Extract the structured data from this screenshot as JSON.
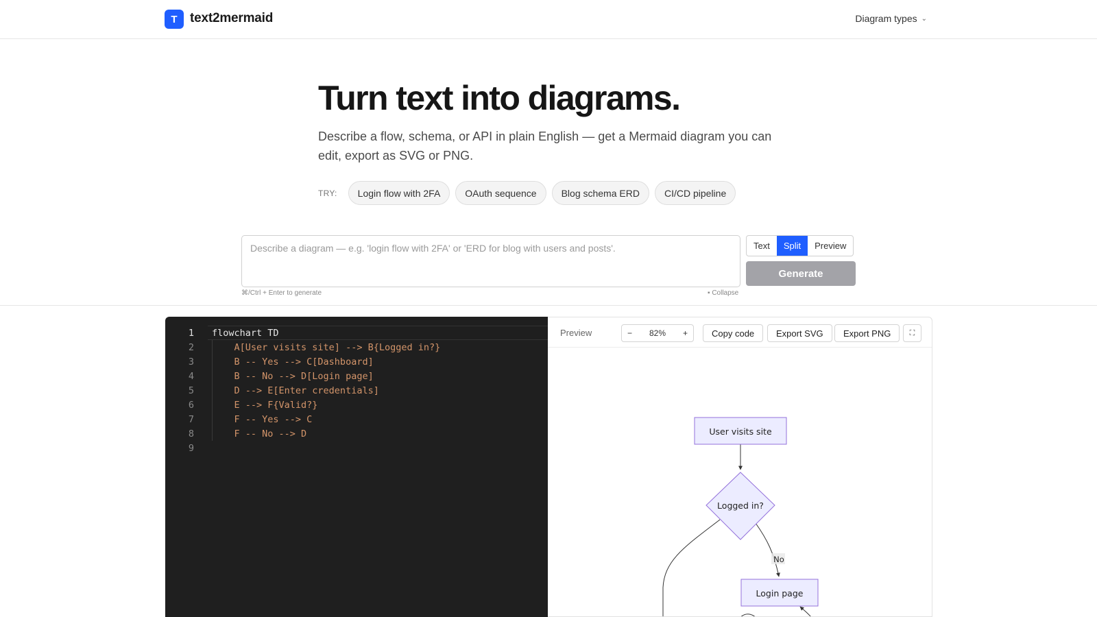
{
  "header": {
    "logo_letter": "T",
    "brand": "text2mermaid",
    "nav_label": "Diagram types"
  },
  "hero": {
    "title": "Turn text into diagrams.",
    "subtitle": "Describe a flow, schema, or API in plain English — get a Mermaid diagram you can edit, export as SVG or PNG."
  },
  "try": {
    "label": "TRY:",
    "chips": [
      "Login flow with 2FA",
      "OAuth sequence",
      "Blog schema ERD",
      "CI/CD pipeline"
    ]
  },
  "prompt": {
    "placeholder": "Describe a diagram — e.g. 'login flow with 2FA' or 'ERD for blog with users and posts'.",
    "value": "",
    "hint": "⌘/Ctrl + Enter to generate",
    "collapse": "▪ Collapse"
  },
  "view_modes": {
    "options": [
      "Text",
      "Split",
      "Preview"
    ],
    "selected": "Split"
  },
  "generate_label": "Generate",
  "editor": {
    "lines": [
      "flowchart TD",
      "    A[User visits site] --> B{Logged in?}",
      "    B -- Yes --> C[Dashboard]",
      "    B -- No --> D[Login page]",
      "    D --> E[Enter credentials]",
      "    E --> F{Valid?}",
      "    F -- Yes --> C",
      "    F -- No --> D",
      ""
    ]
  },
  "preview": {
    "label": "Preview",
    "zoom_minus": "−",
    "zoom": "82%",
    "zoom_plus": "+",
    "copy_code": "Copy code",
    "export_svg": "Export SVG",
    "export_png": "Export PNG",
    "fullscreen_icon": "⛶"
  },
  "diagram": {
    "node_user": "User visits site",
    "node_logged": "Logged in?",
    "node_login": "Login page",
    "edge_no": "No"
  },
  "colors": {
    "accent": "#1f5eff",
    "node_fill": "#ececff",
    "node_stroke": "#9370db",
    "editor_bg": "#1f1f1f",
    "code_text": "#d4956a"
  }
}
